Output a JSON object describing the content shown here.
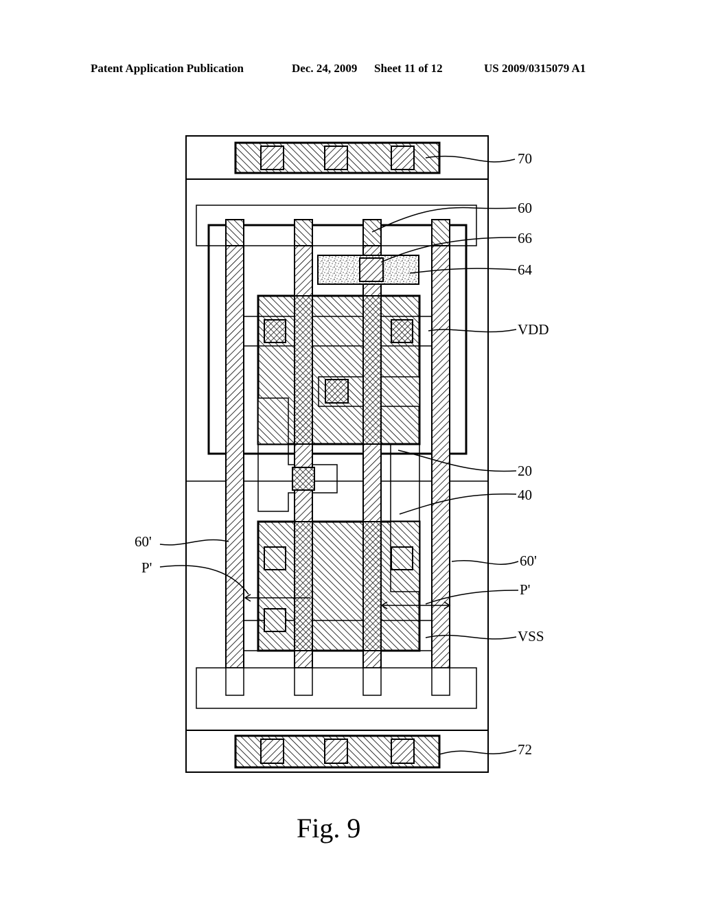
{
  "header": {
    "publication": "Patent Application Publication",
    "date": "Dec. 24, 2009",
    "sheet": "Sheet 11 of 12",
    "number": "US 2009/0315079 A1"
  },
  "figure": {
    "caption": "Fig. 9",
    "labels": {
      "l70": "70",
      "l60": "60",
      "l66": "66",
      "l64": "64",
      "vdd": "VDD",
      "l20": "20",
      "l40": "40",
      "l60p_left": "60'",
      "pp_left": "P'",
      "l60p_right": "60'",
      "pp_right": "P'",
      "vss": "VSS",
      "l72": "72"
    }
  }
}
